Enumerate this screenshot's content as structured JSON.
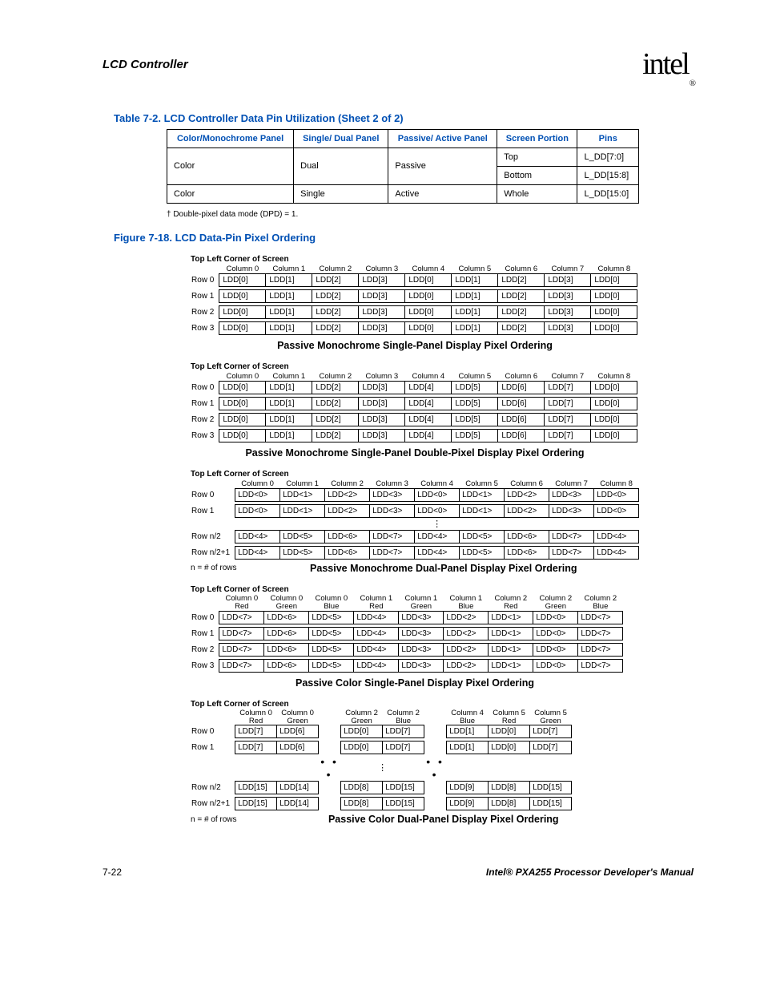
{
  "header": {
    "section": "LCD Controller",
    "logo": "intel",
    "reg": "®"
  },
  "tableCaption": "Table 7-2. LCD Controller Data Pin Utilization (Sheet 2 of 2)",
  "mainTable": {
    "headers": [
      "Color/Monochrome Panel",
      "Single/ Dual Panel",
      "Passive/ Active Panel",
      "Screen Portion",
      "Pins"
    ],
    "rows": [
      [
        "Color",
        "Dual",
        "Passive",
        "Top",
        "L_DD[7:0]"
      ],
      [
        "",
        "",
        "",
        "Bottom",
        "L_DD[15:8]"
      ],
      [
        "Color",
        "Single",
        "Active",
        "Whole",
        "L_DD[15:0]"
      ]
    ]
  },
  "footnote": "† Double-pixel data mode (DPD) = 1.",
  "figCaption": "Figure 7-18. LCD Data-Pin Pixel Ordering",
  "tlc": "Top Left Corner of Screen",
  "colHeads": [
    "Column 0",
    "Column 1",
    "Column 2",
    "Column 3",
    "Column 4",
    "Column 5",
    "Column 6",
    "Column 7",
    "Column 8"
  ],
  "blockA": {
    "rows": [
      "Row 0",
      "Row 1",
      "Row 2",
      "Row 3"
    ],
    "cells": [
      "LDD[0]",
      "LDD[1]",
      "LDD[2]",
      "LDD[3]",
      "LDD[0]",
      "LDD[1]",
      "LDD[2]",
      "LDD[3]",
      "LDD[0]"
    ],
    "caption": "Passive Monochrome Single-Panel Display Pixel Ordering"
  },
  "blockB": {
    "rows": [
      "Row 0",
      "Row 1",
      "Row 2",
      "Row 3"
    ],
    "cells": [
      "LDD[0]",
      "LDD[1]",
      "LDD[2]",
      "LDD[3]",
      "LDD[4]",
      "LDD[5]",
      "LDD[6]",
      "LDD[7]",
      "LDD[0]"
    ],
    "caption": "Passive Monochrome Single-Panel Double-Pixel Display Pixel Ordering"
  },
  "blockC": {
    "rowsTop": [
      "Row 0",
      "Row 1"
    ],
    "rowsBot": [
      "Row n/2",
      "Row n/2+1"
    ],
    "cellsTop": [
      "LDD<0>",
      "LDD<1>",
      "LDD<2>",
      "LDD<3>",
      "LDD<0>",
      "LDD<1>",
      "LDD<2>",
      "LDD<3>",
      "LDD<0>"
    ],
    "cellsBot": [
      "LDD<4>",
      "LDD<5>",
      "LDD<6>",
      "LDD<7>",
      "LDD<4>",
      "LDD<5>",
      "LDD<6>",
      "LDD<7>",
      "LDD<4>"
    ],
    "caption": "Passive Monochrome Dual-Panel Display Pixel Ordering",
    "nrows": "n = # of rows"
  },
  "blockD": {
    "heads": [
      [
        "Column 0",
        "Red"
      ],
      [
        "Column 0",
        "Green"
      ],
      [
        "Column 0",
        "Blue"
      ],
      [
        "Column 1",
        "Red"
      ],
      [
        "Column 1",
        "Green"
      ],
      [
        "Column 1",
        "Blue"
      ],
      [
        "Column 2",
        "Red"
      ],
      [
        "Column 2",
        "Green"
      ],
      [
        "Column 2",
        "Blue"
      ]
    ],
    "rows": [
      "Row 0",
      "Row 1",
      "Row 2",
      "Row 3"
    ],
    "cells": [
      "LDD<7>",
      "LDD<6>",
      "LDD<5>",
      "LDD<4>",
      "LDD<3>",
      "LDD<2>",
      "LDD<1>",
      "LDD<0>",
      "LDD<7>"
    ],
    "caption": "Passive Color Single-Panel Display Pixel Ordering"
  },
  "blockE": {
    "heads": [
      [
        "Column 0",
        "Red"
      ],
      [
        "Column 0",
        "Green"
      ],
      [
        "Column 2",
        "Green"
      ],
      [
        "Column 2",
        "Blue"
      ],
      [
        "Column 4",
        "Blue"
      ],
      [
        "Column 5",
        "Red"
      ],
      [
        "Column 5",
        "Green"
      ]
    ],
    "rowsTop": [
      "Row 0",
      "Row 1"
    ],
    "rowsBot": [
      "Row n/2",
      "Row n/2+1"
    ],
    "cellsTop": [
      "LDD[7]",
      "LDD[6]",
      "LDD[0]",
      "LDD[7]",
      "LDD[1]",
      "LDD[0]",
      "LDD[7]"
    ],
    "cellsBot": [
      "LDD[15]",
      "LDD[14]",
      "LDD[8]",
      "LDD[15]",
      "LDD[9]",
      "LDD[8]",
      "LDD[15]"
    ],
    "caption": "Passive Color Dual-Panel Display Pixel Ordering",
    "nrows": "n = # of rows"
  },
  "footer": {
    "left": "7-22",
    "right": "Intel® PXA255 Processor Developer's Manual"
  }
}
